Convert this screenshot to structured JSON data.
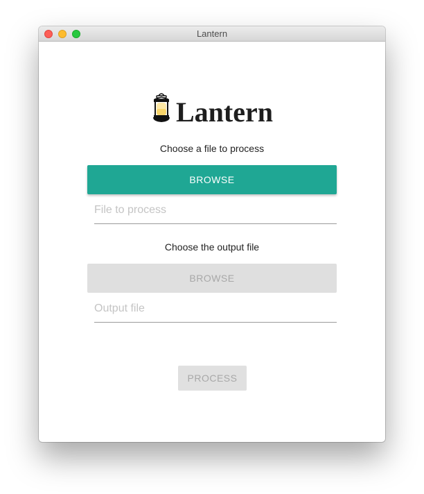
{
  "window": {
    "title": "Lantern"
  },
  "logo": {
    "icon": "lantern-icon",
    "text": "Lantern"
  },
  "input_section": {
    "label": "Choose a file to process",
    "browse_label": "BROWSE",
    "placeholder": "File to process",
    "value": ""
  },
  "output_section": {
    "label": "Choose the output file",
    "browse_label": "BROWSE",
    "placeholder": "Output file",
    "value": ""
  },
  "process_button": {
    "label": "PROCESS"
  },
  "colors": {
    "accent": "#1fa794",
    "disabled_bg": "#dfdfdf",
    "disabled_text": "#a8a8a8"
  }
}
